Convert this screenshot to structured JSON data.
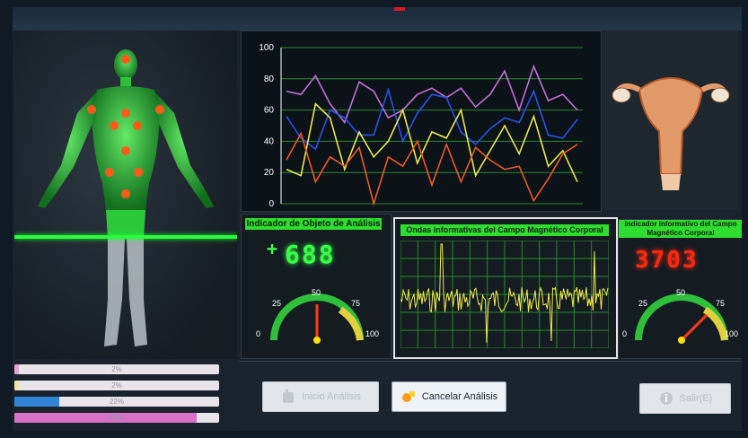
{
  "gauges": {
    "left": {
      "header": "Indicador de Objeto de Análisis",
      "sign": "+",
      "digits": "688",
      "ticks": [
        "0",
        "25",
        "50",
        "75",
        "100"
      ],
      "needle_percent": 50
    },
    "right": {
      "header": "Indicador Informativo del Campo Magnético Corporal",
      "digits": "3703",
      "ticks": [
        "0",
        "25",
        "50",
        "75",
        "100"
      ],
      "needle_percent": 75
    }
  },
  "waves": {
    "header": "Ondas informativas del Campo Magnético Corporal"
  },
  "chart_data": {
    "type": "line",
    "ylim": [
      0,
      100
    ],
    "yticks": [
      "0",
      "20",
      "40",
      "60",
      "80",
      "100"
    ],
    "series": [
      {
        "values": [
          72,
          70,
          82,
          64,
          52,
          78,
          72,
          55,
          60,
          70,
          74,
          68,
          74,
          62,
          70,
          85,
          60,
          88,
          66,
          70,
          60
        ],
        "color": "#c470d8"
      },
      {
        "values": [
          56,
          42,
          35,
          60,
          55,
          44,
          44,
          73,
          40,
          58,
          70,
          68,
          46,
          38,
          48,
          55,
          52,
          72,
          44,
          42,
          54
        ],
        "color": "#2a52e8"
      },
      {
        "values": [
          22,
          18,
          64,
          55,
          22,
          46,
          30,
          40,
          60,
          26,
          46,
          42,
          60,
          18,
          34,
          50,
          32,
          56,
          24,
          34,
          14
        ],
        "color": "#e8e84a"
      },
      {
        "values": [
          28,
          45,
          14,
          30,
          24,
          36,
          0,
          30,
          24,
          40,
          12,
          38,
          14,
          36,
          28,
          22,
          24,
          2,
          16,
          32,
          38
        ],
        "color": "#ee5a28"
      }
    ]
  },
  "progress": [
    {
      "label": "2%",
      "value": 2,
      "color": "#e7a4d0"
    },
    {
      "label": "2%",
      "value": 2,
      "color": "#f2e6a8"
    },
    {
      "label": "22%",
      "value": 22,
      "color": "#2f84d8"
    },
    {
      "label": "89%",
      "value": 89,
      "color": "#d870c8"
    }
  ],
  "buttons": {
    "start": "Inicio Análisis",
    "cancel": "Cancelar Análisis",
    "exit": "Salir(E)"
  },
  "colors": {
    "accent_green": "#2fdc2f",
    "marker_orange": "#ff5a1a",
    "led_red": "#ff2a10",
    "led_green": "#3aff4a"
  }
}
